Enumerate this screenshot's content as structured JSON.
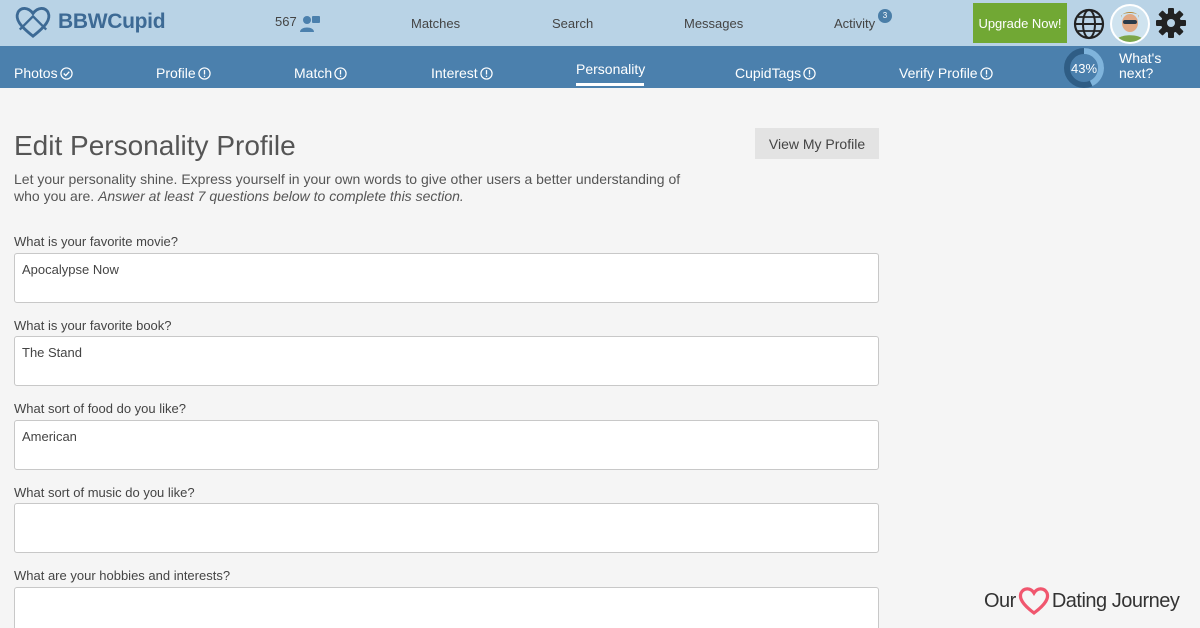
{
  "app": {
    "name": "BBWCupid"
  },
  "topbar": {
    "count": "567",
    "nav": [
      "Matches",
      "Search",
      "Messages",
      "Activity"
    ],
    "activity_badge": "3",
    "upgrade_label": "Upgrade Now!"
  },
  "subnav": {
    "items": [
      "Photos",
      "Profile",
      "Match",
      "Interest",
      "Personality",
      "CupidTags",
      "Verify Profile"
    ],
    "active": "Personality",
    "progress": "43%",
    "progress_fraction": 0.43,
    "whats_next": "What's next?"
  },
  "main": {
    "title": "Edit Personality Profile",
    "view_button": "View My Profile",
    "intro_text": "Let your personality shine. Express yourself in your own words to give other users a better understanding of who you are.",
    "intro_hint": "Answer at least 7 questions below to complete this section.",
    "questions": [
      {
        "label": "What is your favorite movie?",
        "value": "Apocalypse Now"
      },
      {
        "label": "What is your favorite book?",
        "value": "The Stand"
      },
      {
        "label": "What sort of food do you like?",
        "value": "American"
      },
      {
        "label": "What sort of music do you like?",
        "value": ""
      },
      {
        "label": "What are your hobbies and interests?",
        "value": ""
      }
    ]
  },
  "watermark": {
    "left": "Our",
    "right": "Dating Journey"
  },
  "colors": {
    "topbar": "#b9d3e6",
    "subnav": "#4b80ad",
    "upgrade": "#71a834",
    "heart": "#f0566e"
  }
}
